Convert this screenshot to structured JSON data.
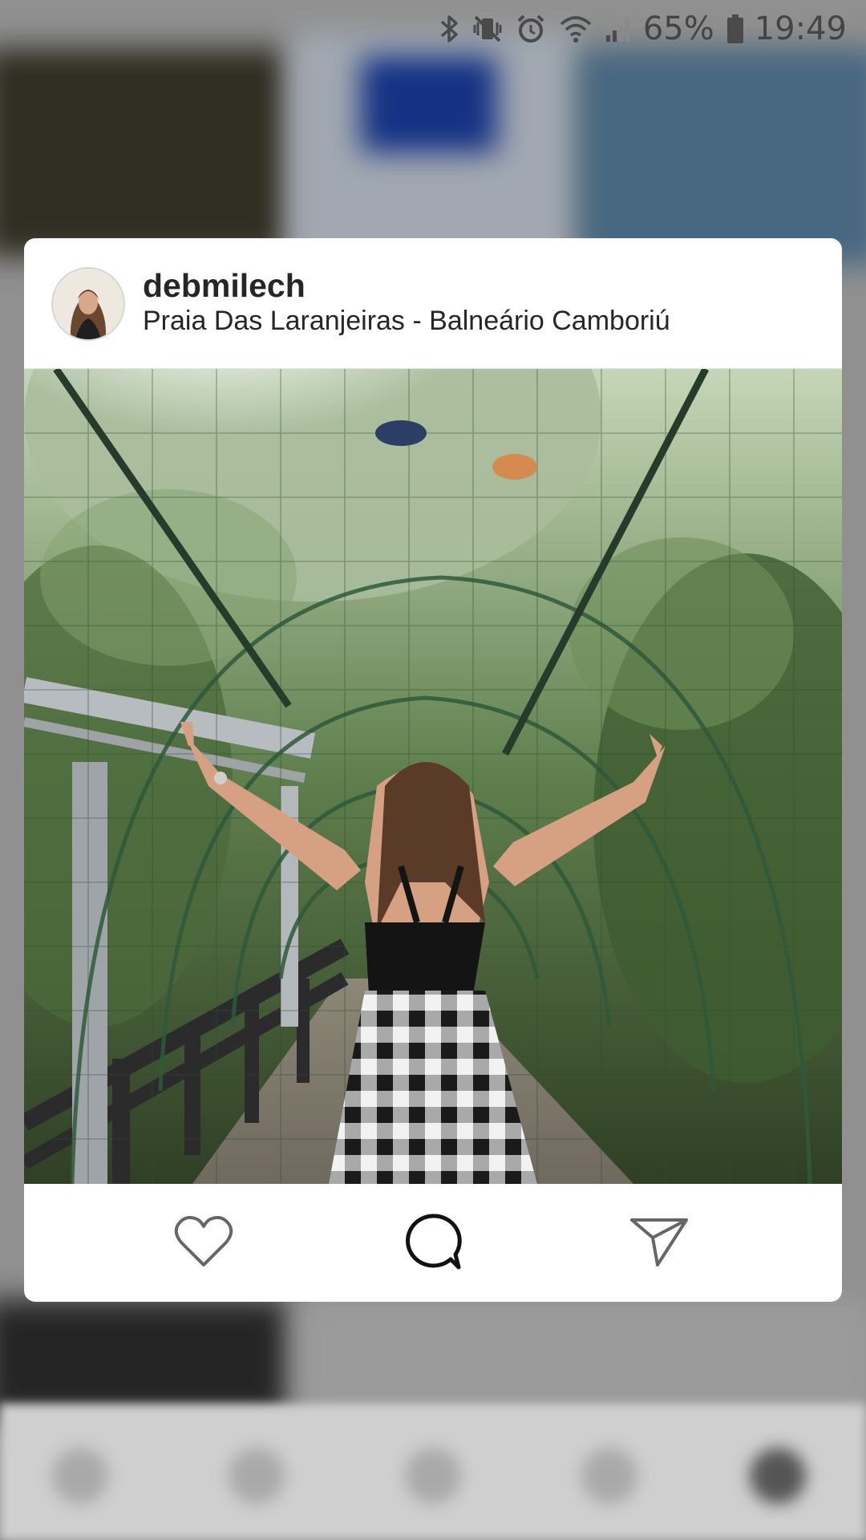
{
  "status_bar": {
    "icons": [
      "bluetooth-icon",
      "vibrate-mute-icon",
      "alarm-icon",
      "wifi-icon",
      "cell-signal-icon",
      "battery-icon"
    ],
    "battery_percent": "65%",
    "time": "19:49"
  },
  "post": {
    "username": "debmilech",
    "location": "Praia Das Laranjeiras - Balneário Camboriú",
    "actions": {
      "like": "heart-icon",
      "comment": "comment-bubble-icon",
      "share": "send-arrow-icon"
    }
  },
  "colors": {
    "card_bg": "#ffffff",
    "text_primary": "#262626",
    "scrim": "#b9b9b9"
  }
}
